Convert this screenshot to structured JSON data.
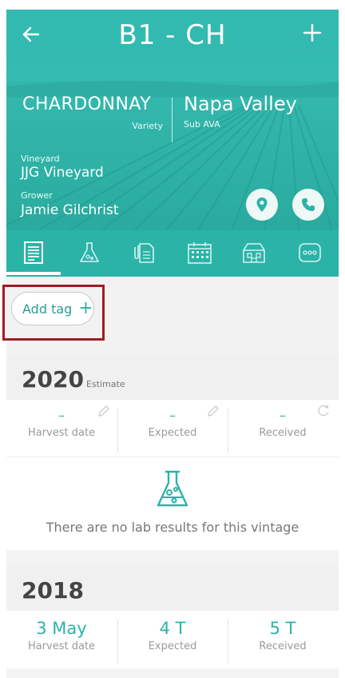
{
  "header": {
    "title": "B1 - CH",
    "variety": "CHARDONNAY",
    "variety_label": "Variety",
    "sub_ava": "Napa Valley",
    "sub_ava_label": "Sub AVA",
    "vineyard_label": "Vineyard",
    "vineyard": "JJG Vineyard",
    "grower_label": "Grower",
    "grower": "Jamie Gilchrist"
  },
  "tabs": [
    {
      "name": "tab-overview",
      "icon": "document-icon",
      "active": true
    },
    {
      "name": "tab-lab",
      "icon": "flask-icon",
      "active": false
    },
    {
      "name": "tab-attachments",
      "icon": "paperclip-file-icon",
      "active": false
    },
    {
      "name": "tab-calendar",
      "icon": "calendar-icon",
      "active": false
    },
    {
      "name": "tab-winery",
      "icon": "building-icon",
      "active": false
    },
    {
      "name": "tab-more",
      "icon": "more-icon",
      "active": false
    }
  ],
  "tags": {
    "add_label": "Add tag",
    "add_icon": "plus-icon"
  },
  "vintages": [
    {
      "year": "2020",
      "tag": "Estimate",
      "stats": [
        {
          "value": "–",
          "label": "Harvest date",
          "icon": "pencil-icon"
        },
        {
          "value": "–",
          "label": "Expected",
          "icon": "pencil-icon"
        },
        {
          "value": "–",
          "label": "Received",
          "icon": "refresh-icon"
        }
      ],
      "empty_lab": "There are no lab results for this vintage"
    },
    {
      "year": "2018",
      "tag": "",
      "stats": [
        {
          "value": "3 May",
          "label": "Harvest date"
        },
        {
          "value": "4 T",
          "label": "Expected"
        },
        {
          "value": "5 T",
          "label": "Received"
        }
      ]
    }
  ],
  "colors": {
    "accent": "#2bb3a8",
    "highlight": "#a01c22"
  }
}
